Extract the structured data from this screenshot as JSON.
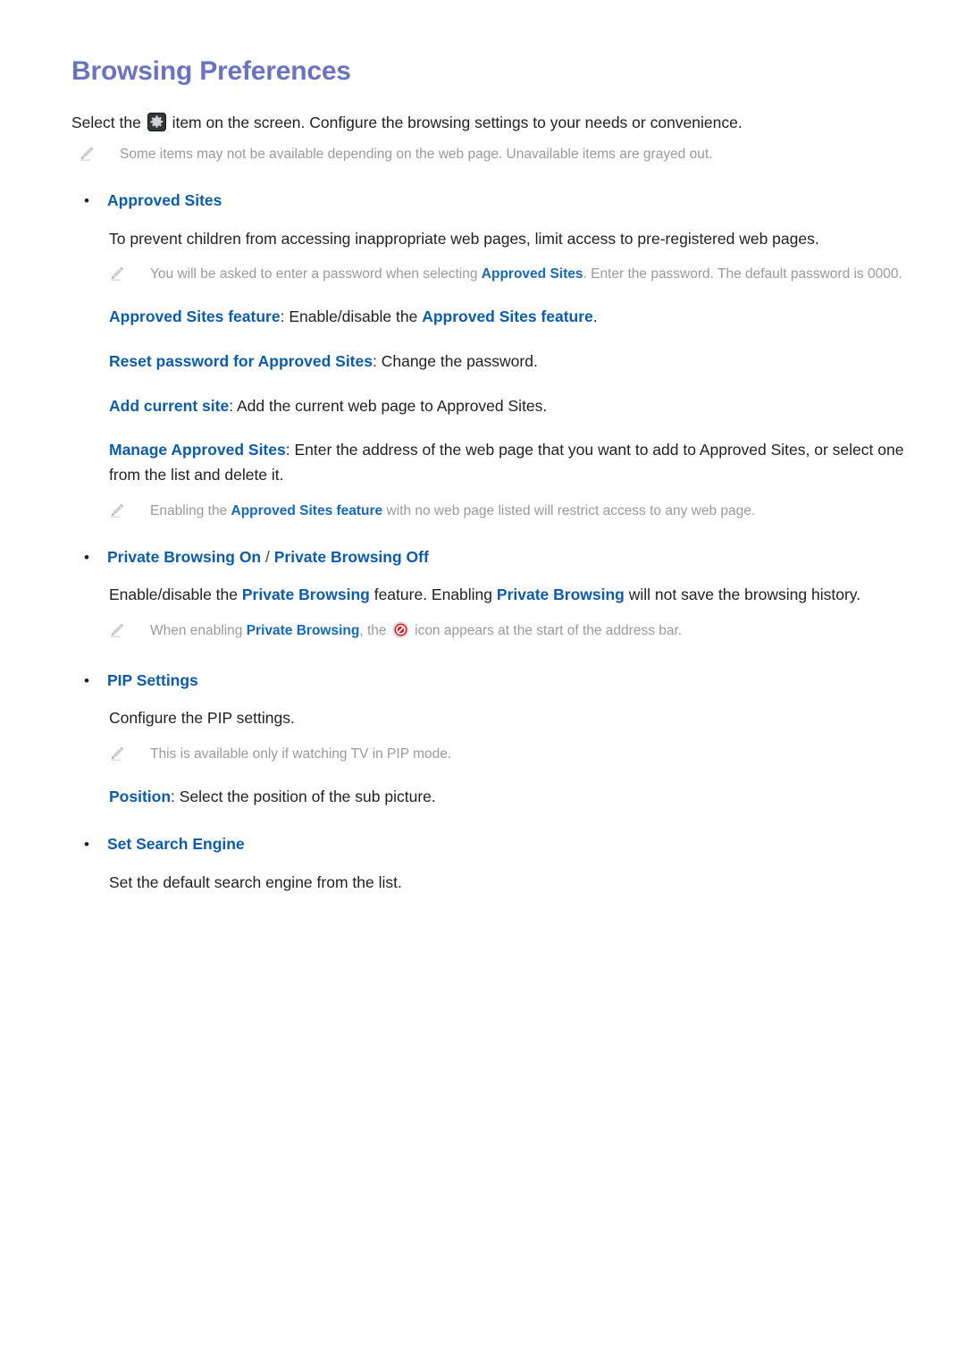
{
  "document": {
    "title": "Browsing Preferences",
    "title_color": "#6b73c0",
    "accent_color": "#0d5ca8",
    "note_color": "#9a9a9a"
  },
  "intro": {
    "before_icon": "Select the ",
    "icon": "gear-icon",
    "after_icon": " item on the screen. Configure the browsing settings to your needs or convenience."
  },
  "top_note": {
    "icon": "pencil-note-icon",
    "text": "Some items may not be available depending on the web page. Unavailable items are grayed out."
  },
  "sections": [
    {
      "bullet": "•",
      "label": "Approved Sites",
      "description": "To prevent children from accessing inappropriate web pages, limit access to pre-registered web pages.",
      "note1": {
        "icon": "pencil-note-icon",
        "part1": "You will be asked to enter a password when selecting ",
        "emphasis": "Approved Sites",
        "part2": ". Enter the password. The default password is 0000."
      },
      "options": [
        {
          "name": "Approved Sites feature",
          "sep": ": ",
          "desc_part1": "Enable/disable the ",
          "desc_emphasis": "Approved Sites feature",
          "desc_part2": "."
        },
        {
          "name": "Reset password for Approved Sites",
          "sep": ": ",
          "desc_part1": "Change the password.",
          "desc_emphasis": "",
          "desc_part2": ""
        },
        {
          "name": "Add current site",
          "sep": ": ",
          "desc_part1": "Add the current web page to Approved Sites.",
          "desc_emphasis": "",
          "desc_part2": ""
        },
        {
          "name": "Manage Approved Sites",
          "sep": ": ",
          "desc_part1": "Enter the address of the web page that you want to add to Approved Sites, or select one from the list and delete it.",
          "desc_emphasis": "",
          "desc_part2": ""
        }
      ],
      "note2": {
        "icon": "pencil-note-icon",
        "part1": "Enabling the ",
        "emphasis": "Approved Sites feature",
        "part2": " with no web page listed will restrict access to any web page."
      }
    },
    {
      "bullet": "•",
      "label_a": "Private Browsing On",
      "label_sep": " / ",
      "label_b": "Private Browsing Off",
      "desc_part1": "Enable/disable the ",
      "desc_em1": "Private Browsing",
      "desc_part2": " feature. Enabling ",
      "desc_em2": "Private Browsing",
      "desc_part3": " will not save the browsing history.",
      "note": {
        "icon": "pencil-note-icon",
        "part1": "When enabling ",
        "emphasis": "Private Browsing",
        "part2": ", the ",
        "inline_icon": "no-entry-icon",
        "part3": " icon appears at the start of the address bar."
      }
    },
    {
      "bullet": "•",
      "label": "PIP Settings",
      "description": "Configure the PIP settings.",
      "note": {
        "icon": "pencil-note-icon",
        "text": "This is available only if watching TV in PIP mode."
      },
      "option": {
        "name": "Position",
        "sep": ": ",
        "desc": "Select the position of the sub picture."
      }
    },
    {
      "bullet": "•",
      "label": "Set Search Engine",
      "description": "Set the default search engine from the list."
    }
  ]
}
